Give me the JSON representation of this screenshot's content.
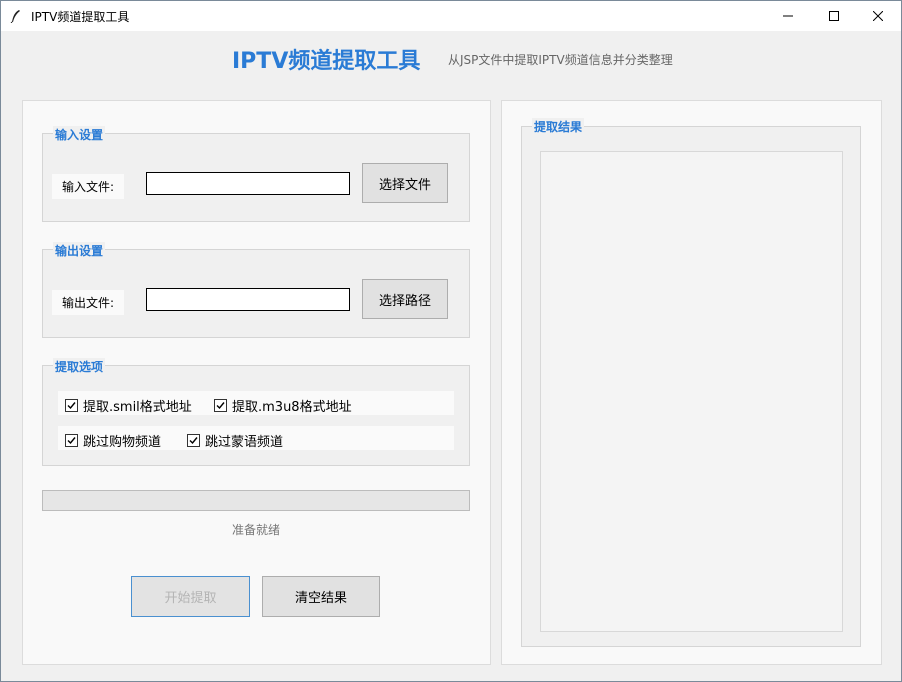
{
  "window": {
    "title": "IPTV频道提取工具",
    "icon": "feather-icon"
  },
  "header": {
    "title": "IPTV频道提取工具",
    "subtitle": "从JSP文件中提取IPTV频道信息并分类整理"
  },
  "input_group": {
    "label": "输入设置",
    "field_label": "输入文件:",
    "value": "",
    "button": "选择文件"
  },
  "output_group": {
    "label": "输出设置",
    "field_label": "输出文件:",
    "value": "",
    "button": "选择路径"
  },
  "options_group": {
    "label": "提取选项",
    "options": [
      {
        "label": "提取.smil格式地址",
        "checked": true
      },
      {
        "label": "提取.m3u8格式地址",
        "checked": true
      },
      {
        "label": "跳过购物频道",
        "checked": true
      },
      {
        "label": "跳过蒙语频道",
        "checked": true
      }
    ]
  },
  "progress": {
    "value": 0
  },
  "status": "准备就绪",
  "actions": {
    "start": "开始提取",
    "clear": "清空结果"
  },
  "results": {
    "label": "提取结果",
    "content": ""
  },
  "colors": {
    "accent": "#2a7bd5",
    "title_text": "#2a7bd5"
  }
}
